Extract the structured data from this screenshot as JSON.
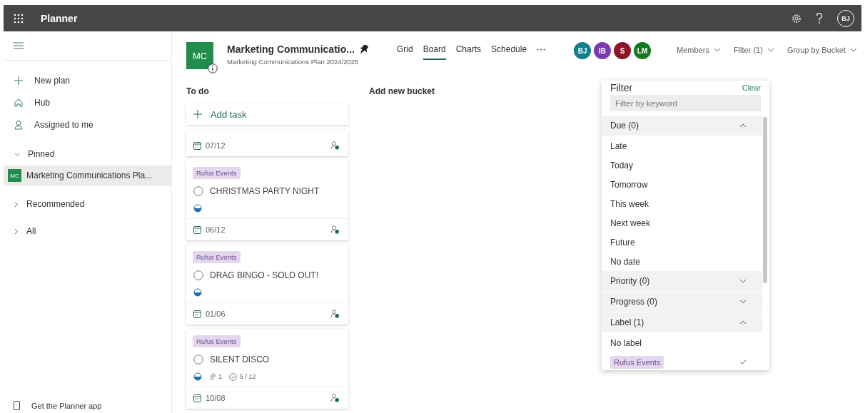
{
  "app_bar": {
    "app_name": "Planner",
    "user_initials": "BJ"
  },
  "sidebar": {
    "nav": [
      {
        "label": "New plan"
      },
      {
        "label": "Hub"
      },
      {
        "label": "Assigned to me"
      }
    ],
    "sections": [
      {
        "label": "Pinned",
        "expanded": true,
        "items": [
          {
            "badge": "MC",
            "label": "Marketing Communications Pla...",
            "selected": true
          }
        ]
      },
      {
        "label": "Recommended",
        "expanded": false
      },
      {
        "label": "All",
        "expanded": false
      }
    ],
    "footer": "Get the Planner app"
  },
  "plan": {
    "badge": "MC",
    "title": "Marketing Communicatio...",
    "subtitle": "Marketing Communications Plan 2024/2025",
    "pinned": true
  },
  "views": [
    {
      "label": "Grid",
      "selected": false
    },
    {
      "label": "Board",
      "selected": true
    },
    {
      "label": "Charts",
      "selected": false
    },
    {
      "label": "Schedule",
      "selected": false
    }
  ],
  "members": [
    {
      "initials": "BJ",
      "color": "#0f7f8a"
    },
    {
      "initials": "IB",
      "color": "#7a3cae"
    },
    {
      "initials": "S",
      "color": "#8c1627"
    },
    {
      "initials": "LM",
      "color": "#137a1f"
    }
  ],
  "toolbar": [
    "Members",
    "Filter (1)",
    "Group by Bucket"
  ],
  "board": {
    "buckets": [
      {
        "title": "To do",
        "add_task": "Add task",
        "tasks": [
          {
            "due": "07/12"
          },
          {
            "label": "Rufus Events",
            "title": "CHRISTMAS PARTY NIGHT",
            "completed": false,
            "in_progress": true,
            "due": "06/12"
          },
          {
            "label": "Rufus Events",
            "title": "DRAG BINGO - SOLD OUT!",
            "completed": false,
            "in_progress": true,
            "due": "01/06"
          },
          {
            "label": "Rufus Events",
            "title": "SILENT DISCO",
            "completed": false,
            "in_progress": true,
            "attachments": "1",
            "checklist": "5 / 12",
            "due": "10/08"
          }
        ]
      }
    ],
    "add_bucket": "Add new bucket"
  },
  "filter": {
    "title": "Filter",
    "clear": "Clear",
    "placeholder": "Filter by keyword",
    "sections": [
      {
        "label": "Due (0)",
        "expanded": true,
        "options": [
          {
            "label": "Late",
            "checked": false
          },
          {
            "label": "Today",
            "checked": false
          },
          {
            "label": "Tomorrow",
            "checked": false
          },
          {
            "label": "This week",
            "checked": false
          },
          {
            "label": "Next week",
            "checked": false
          },
          {
            "label": "Future",
            "checked": false
          },
          {
            "label": "No date",
            "checked": false
          }
        ]
      },
      {
        "label": "Priority (0)",
        "expanded": false
      },
      {
        "label": "Progress (0)",
        "expanded": false
      },
      {
        "label": "Label (1)",
        "expanded": true,
        "options": [
          {
            "label": "No label",
            "checked": false,
            "kind": "text"
          },
          {
            "label": "Rufus Events",
            "checked": true,
            "kind": "tag"
          }
        ]
      }
    ]
  }
}
